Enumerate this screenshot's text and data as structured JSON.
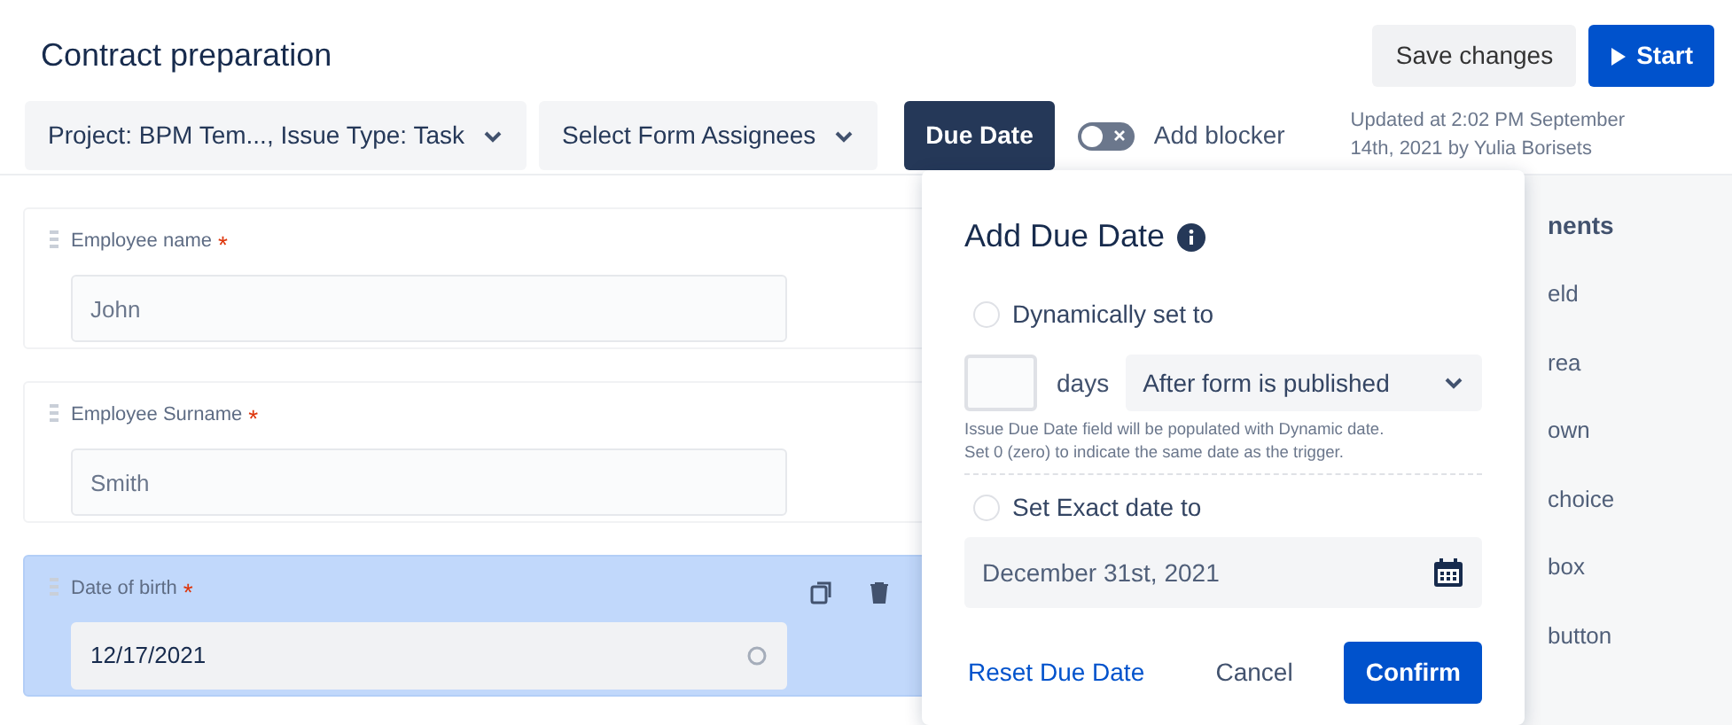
{
  "header": {
    "title": "Contract preparation",
    "buttons": [
      {
        "label": "Save changes",
        "kind": "secondary"
      },
      {
        "label": "Start",
        "kind": "primary"
      }
    ]
  },
  "toolbar": {
    "dropdowns": [
      "Project: BPM Tem..., Issue Type: Task",
      "Select Form Assignees"
    ],
    "due_date_button": {
      "label": "Due Date",
      "selected": true
    },
    "blocker_toggle": {
      "label": "Add blocker",
      "on": false
    },
    "updated": "Updated at 2:02 PM September 14th, 2021 by Yulia Borisets"
  },
  "form_fields": [
    {
      "label": "Employee name",
      "required_mark": "*",
      "kind": "text",
      "placeholder": "John",
      "selected": false
    },
    {
      "label": "Employee Surname",
      "required_mark": "*",
      "kind": "text",
      "placeholder": "Smith",
      "selected": false
    },
    {
      "label": "Date of birth",
      "required_mark": "*",
      "kind": "date",
      "value": "12/17/2021",
      "selected": true
    }
  ],
  "components_panel": {
    "title": "nents",
    "items": [
      "eld",
      "rea",
      "own",
      "choice",
      "box",
      "button"
    ]
  },
  "due_date_popover": {
    "title": "Add Due Date",
    "options": [
      {
        "label": "Dynamically set to",
        "selected": false
      },
      {
        "label": "Set Exact date to",
        "selected": false
      }
    ],
    "days_unit": "days",
    "trigger_select": "After form is published",
    "hint_lines": [
      "Issue Due Date field will be populated with Dynamic date.",
      "Set 0 (zero) to indicate the same date as the trigger."
    ],
    "exact_date": "December 31st, 2021",
    "reset_link": "Reset Due Date",
    "cancel_button": "Cancel",
    "confirm_button": "Confirm"
  }
}
